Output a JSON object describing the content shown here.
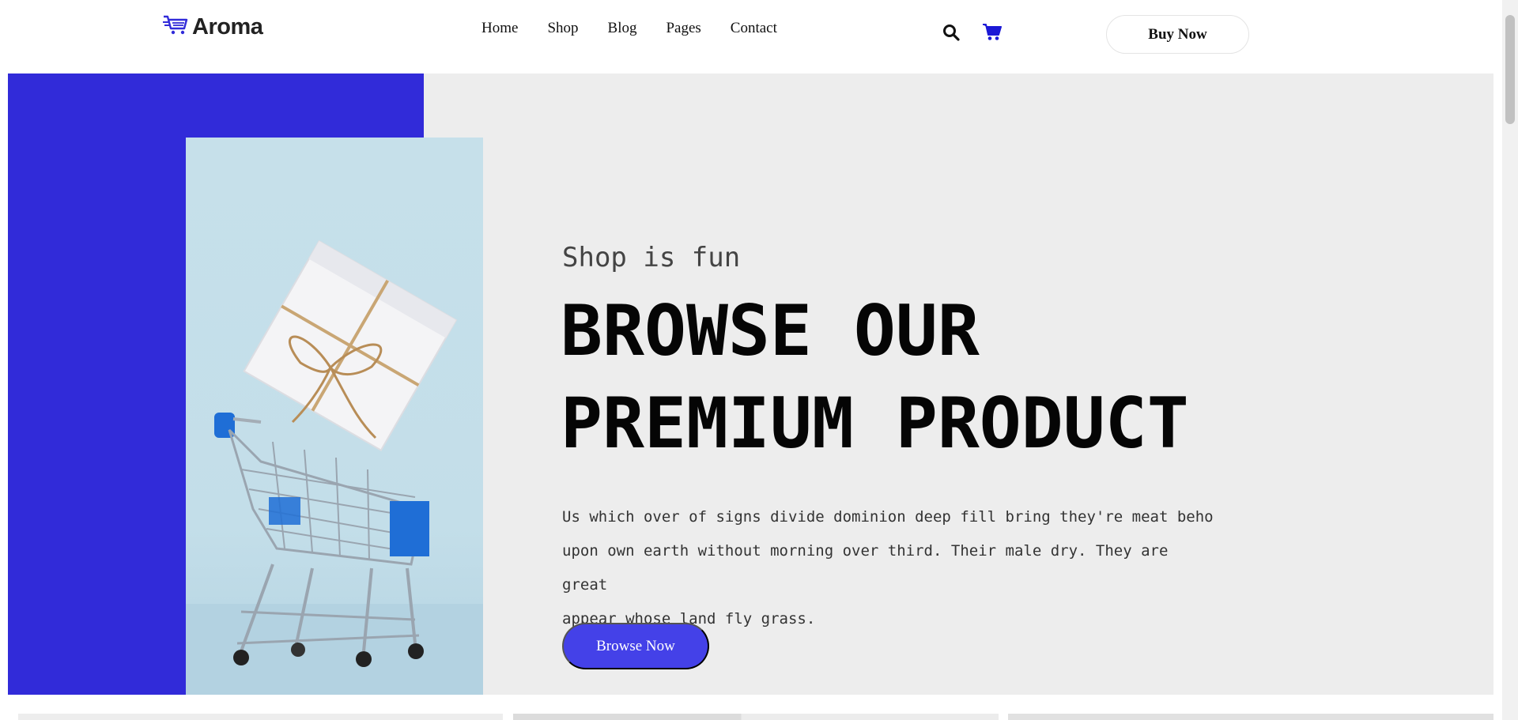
{
  "header": {
    "logo_text": "Aroma",
    "logo_icon": "cart-lines-icon",
    "nav": [
      {
        "label": "Home"
      },
      {
        "label": "Shop"
      },
      {
        "label": "Blog"
      },
      {
        "label": "Pages"
      },
      {
        "label": "Contact"
      }
    ],
    "search_icon": "search-icon",
    "cart_icon": "cart-icon",
    "cta_label": "Buy Now"
  },
  "hero": {
    "eyebrow": "Shop is fun",
    "headline_line1": "BROWSE OUR",
    "headline_line2": "PREMIUM PRODUCT",
    "body_line1": "Us which over of signs divide dominion deep fill bring they're meat beho",
    "body_line2": "upon own earth without morning over third. Their male dry. They are great",
    "body_line3": "appear whose land fly grass.",
    "button_label": "Browse Now",
    "image": "shopping-cart-with-gift-box"
  },
  "colors": {
    "accent_blue": "#312bd9",
    "button_blue": "#4441e8",
    "cart_icon_blue": "#1c19d6",
    "hero_bg": "#ededed"
  }
}
